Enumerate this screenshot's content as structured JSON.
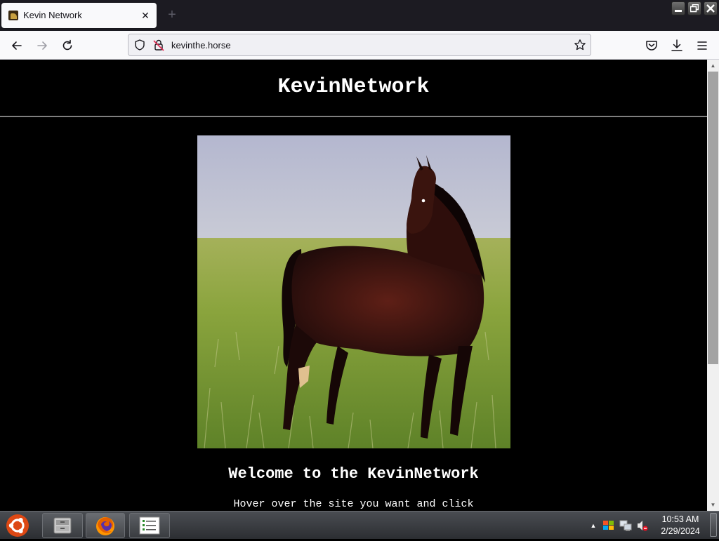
{
  "browser": {
    "tab_title": "Kevin Network",
    "url": "kevinthe.horse"
  },
  "page": {
    "site_title": "KevinNetwork",
    "welcome_heading": "Welcome to the KevinNetwork",
    "instruction_text": "Hover over the site you want and click"
  },
  "taskbar": {
    "time": "10:53 AM",
    "date": "2/29/2024"
  }
}
